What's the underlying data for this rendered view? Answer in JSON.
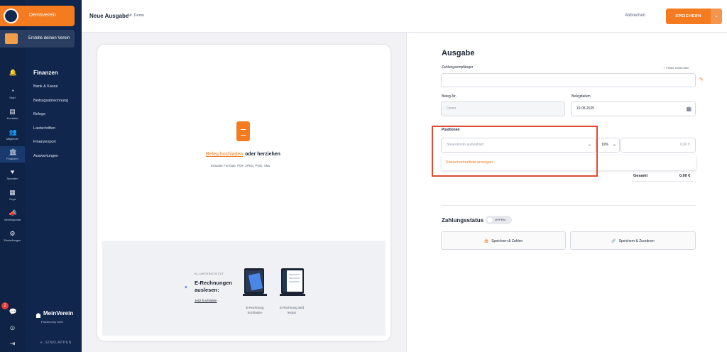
{
  "sidebar": {
    "org_active": "Demoverein",
    "org_create": "Erstelle deinen Verein",
    "rail": [
      {
        "icon": "bell-icon",
        "label": ""
      },
      {
        "icon": "dashboard-icon",
        "label": "Start"
      },
      {
        "icon": "contacts-icon",
        "label": "Kontakte"
      },
      {
        "icon": "members-icon",
        "label": "Mitglieder"
      },
      {
        "icon": "bank-icon",
        "label": "Finanzen"
      },
      {
        "icon": "donations-icon",
        "label": "Spenden"
      },
      {
        "icon": "calendar-icon",
        "label": "Orga"
      },
      {
        "icon": "megaphone-icon",
        "label": "Vereinsportal"
      },
      {
        "icon": "gear-icon",
        "label": "Einstellungen"
      }
    ],
    "notifications_badge": "2",
    "section_title": "Finanzen",
    "items": [
      "Bank & Kasse",
      "Beitragsabrechnung",
      "Belege",
      "Lastschriften",
      "Finanzexport",
      "Auswertungen"
    ],
    "brand": "MeinVerein",
    "brand_sub": "Powered by SoSi",
    "collapse": "EINKLAPPEN"
  },
  "header": {
    "title": "Neue Ausgabe",
    "number": "Nr. Demo",
    "cancel": "Abbrechen",
    "save": "SPEICHERN"
  },
  "upload": {
    "link": "Beleg hochladen",
    "text": "oder herziehen",
    "formats": "Erlaubte Formate: PDF, JPEG, PNG, XML",
    "ki_label": "KI-UNTERSTÜTZT",
    "einvoice_title": "E-Rechnungen auslesen:",
    "einvoice_link": "Jetzt hochladen",
    "caption_1": "E-Rechnung hochladen",
    "caption_2": "E-Rechnung wird lesbar"
  },
  "form": {
    "title": "Ausgabe",
    "payee_label": "Zahlungsempfänger",
    "show_fields": "Felder einblenden",
    "receipt_no_label": "Beleg-Nr.",
    "receipt_no_placeholder": "Demo",
    "receipt_date_label": "Belegdatum",
    "receipt_date": "19.05.2025",
    "positions_label": "Positionen",
    "account_placeholder": "Steuerkonto auswählen",
    "vat": "19%",
    "amount": "0,00 €",
    "dropdown_option": "Steuerkontenliste anzeigen",
    "total_label": "Gesamt",
    "total_value": "0,00 €",
    "payment_status_title": "Zahlungsstatus",
    "payment_status": "OFFEN",
    "btn_save_pay": "Speichern & Zahlen",
    "btn_save_assign": "Speichern & Zuordnen"
  },
  "colors": {
    "accent": "#f47b20",
    "navy": "#0f2347",
    "highlight": "#e04a2f"
  }
}
